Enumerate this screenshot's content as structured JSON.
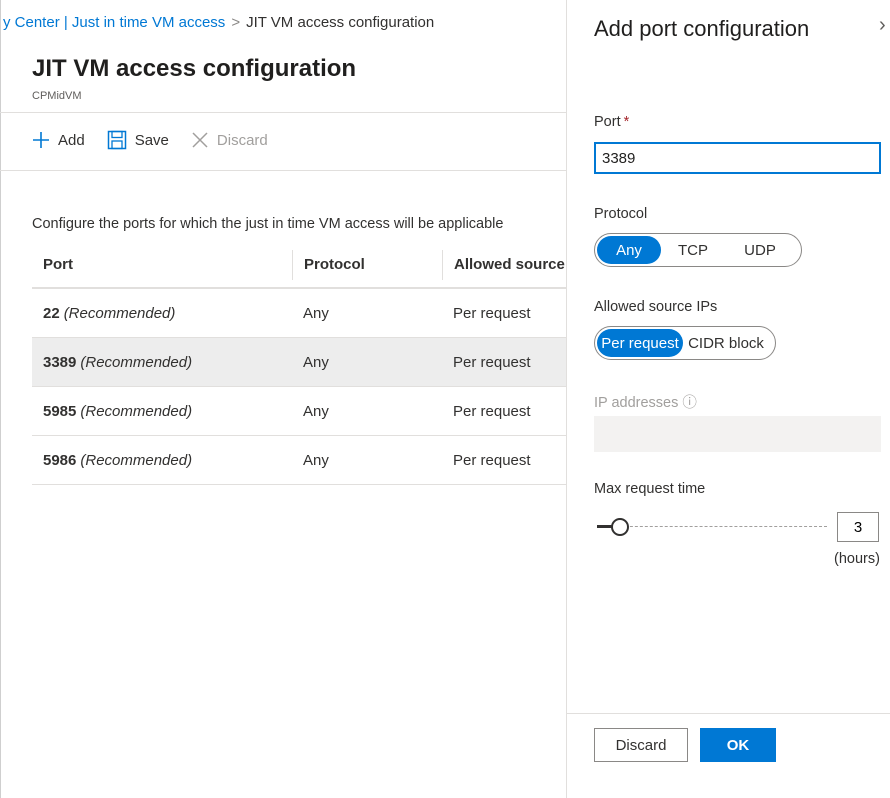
{
  "breadcrumb": {
    "part1": "y Center | Just in time VM access",
    "separator": ">",
    "current": "JIT VM access configuration"
  },
  "page": {
    "title": "JIT VM access configuration",
    "subtitle": "CPMidVM"
  },
  "toolbar": {
    "add_label": "Add",
    "save_label": "Save",
    "discard_label": "Discard"
  },
  "description": "Configure the ports for which the just in time VM access will be applicable",
  "table": {
    "columns": [
      "Port",
      "Protocol",
      "Allowed source IP"
    ],
    "rows": [
      {
        "port": "22",
        "note": "(Recommended)",
        "protocol": "Any",
        "source": "Per request"
      },
      {
        "port": "3389",
        "note": "(Recommended)",
        "protocol": "Any",
        "source": "Per request"
      },
      {
        "port": "5985",
        "note": "(Recommended)",
        "protocol": "Any",
        "source": "Per request"
      },
      {
        "port": "5986",
        "note": "(Recommended)",
        "protocol": "Any",
        "source": "Per request"
      }
    ],
    "selected_row": 1
  },
  "panel": {
    "title": "Add port configuration",
    "close_glyph": "›",
    "port_label": "Port",
    "required_mark": "*",
    "port_value": "3389",
    "protocol_label": "Protocol",
    "protocol_options": [
      "Any",
      "TCP",
      "UDP"
    ],
    "protocol_selected": "Any",
    "allowed_ips_label": "Allowed source IPs",
    "allowed_ips_options": [
      "Per request",
      "CIDR block"
    ],
    "allowed_ips_selected": "Per request",
    "ip_addresses_label": "IP addresses",
    "info_glyph": "ⓘ",
    "max_request_label": "Max request time",
    "max_request_value": "3",
    "hours_label": "(hours)",
    "slider_fraction": 0.1,
    "discard_label": "Discard",
    "ok_label": "OK"
  },
  "colors": {
    "accent": "#0078d4",
    "required": "#a4262c",
    "selected_row": "#ededed"
  }
}
